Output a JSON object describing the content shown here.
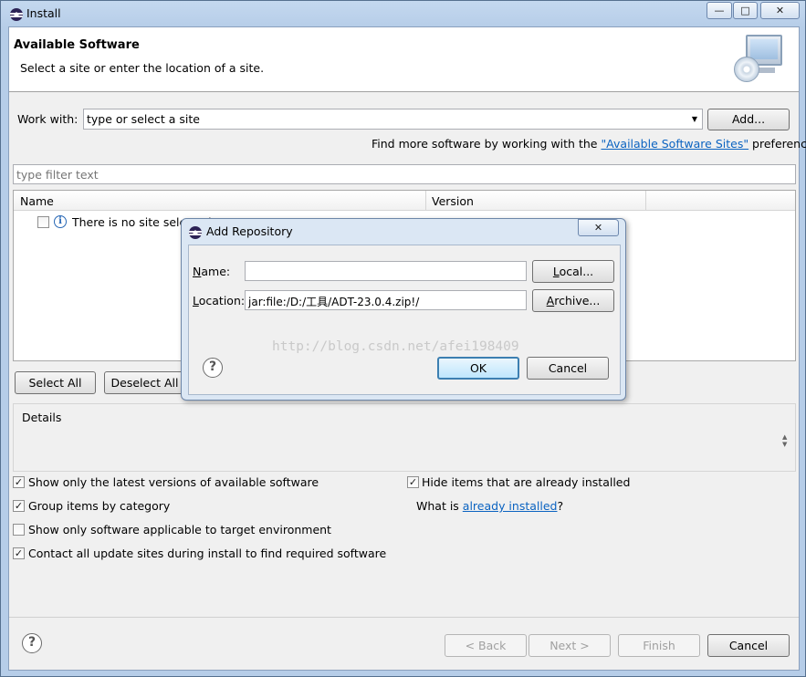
{
  "window": {
    "title": "Install",
    "min": "—",
    "max": "□",
    "close": "✕"
  },
  "header": {
    "title": "Available Software",
    "subtitle": "Select a site or enter the location of a site."
  },
  "work_with": {
    "label": "Work with:",
    "value": "type or select a site",
    "add_button": "Add...",
    "find_more_prefix": "Find more software by working with the ",
    "find_more_link": "\"Available Software Sites\"",
    "find_more_suffix": " preferences."
  },
  "filter": {
    "placeholder": "type filter text"
  },
  "table": {
    "columns": [
      "Name",
      "Version"
    ],
    "rows": [
      {
        "name": "There is no site selected."
      }
    ]
  },
  "selection_buttons": {
    "select_all": "Select All",
    "deselect_all": "Deselect All"
  },
  "details": {
    "label": "Details"
  },
  "options": {
    "latest_versions": {
      "label": "Show only the latest versions of available software",
      "checked": true
    },
    "group_by_category": {
      "label": "Group items by category",
      "checked": true
    },
    "applicable_only": {
      "label": "Show only software applicable to target environment",
      "checked": false
    },
    "contact_sites": {
      "label": "Contact all update sites during install to find required software",
      "checked": true
    },
    "hide_installed": {
      "label": "Hide items that are already installed",
      "checked": true
    },
    "what_is_prefix": "What is ",
    "what_is_link": "already installed",
    "what_is_suffix": "?"
  },
  "footer": {
    "back": "< Back",
    "next": "Next >",
    "finish": "Finish",
    "cancel": "Cancel"
  },
  "dialog": {
    "title": "Add Repository",
    "close": "✕",
    "name_label_mn": "N",
    "name_label_rest": "ame:",
    "name_value": "",
    "local_mn": "L",
    "local_rest": "ocal...",
    "location_label_mn": "L",
    "location_label_rest": "ocation:",
    "location_value": "jar:file:/D:/工具/ADT-23.0.4.zip!/",
    "archive_mn": "A",
    "archive_rest": "rchive...",
    "ok": "OK",
    "cancel": "Cancel",
    "watermark": "http://blog.csdn.net/afei198409"
  }
}
